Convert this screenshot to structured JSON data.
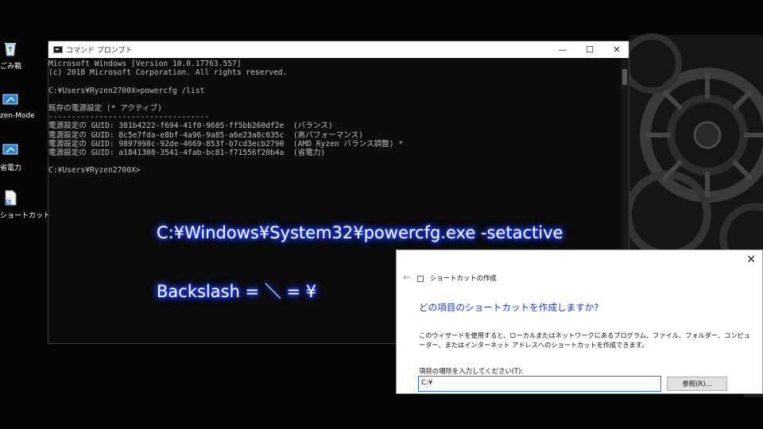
{
  "desktop": {
    "icons": [
      {
        "label": "ごみ箱",
        "icon": "recycle-bin-icon"
      },
      {
        "label": "zen-Mode",
        "icon": "shortcut-icon"
      },
      {
        "label": "省電力",
        "icon": "shortcut-icon"
      },
      {
        "label": "ショートカット",
        "icon": "document-shortcut-icon"
      }
    ]
  },
  "cmd_window": {
    "title": "コマンド プロンプト",
    "controls": {
      "minimize": "—",
      "maximize": "☐",
      "close": "✕"
    },
    "lines": [
      "Microsoft Windows [Version 10.0.17763.557]",
      "(c) 2018 Microsoft Corporation. All rights reserved.",
      "",
      "C:¥Users¥Ryzen2700X>powercfg /list",
      "",
      "既存の電源設定 (* アクティブ)",
      "-----------------------------------",
      "電源設定の GUID: 381b4222-f694-41f0-9685-ff5bb260df2e  (バランス)",
      "電源設定の GUID: 8c5e7fda-e8bf-4a96-9a85-a6e23a8c635c  (高パフォーマンス)",
      "電源設定の GUID: 9897998c-92de-4669-853f-b7cd3ecb2790  (AMD Ryzen バランス調整) *",
      "電源設定の GUID: a1841308-3541-4fab-bc81-f71556f20b4a  (省電力)",
      "",
      "C:¥Users¥Ryzen2700X>"
    ]
  },
  "captions": {
    "path": "C:¥Windows¥System32¥powercfg.exe -setactive",
    "note": "Backslash = ＼ = ¥"
  },
  "shortcut_dialog": {
    "close_glyph": "✕",
    "back_glyph": "←",
    "window_title": "ショートカットの作成",
    "heading": "どの項目のショートカットを作成しますか?",
    "description": "このウィザードを使用すると、ローカルまたはネットワークにあるプログラム、ファイル、フォルダー、コンピューター、またはインターネット アドレスへのショートカットを作成できます。",
    "field_label": "項目の場所を入力してください(T):",
    "location_value": "C:¥",
    "browse_button": "参照(R)..."
  },
  "colors": {
    "console_bg": "#0c0c0c",
    "console_text": "#c0c0c0",
    "caption_glow": "#2b4bff",
    "dialog_heading": "#1a3bb0"
  }
}
